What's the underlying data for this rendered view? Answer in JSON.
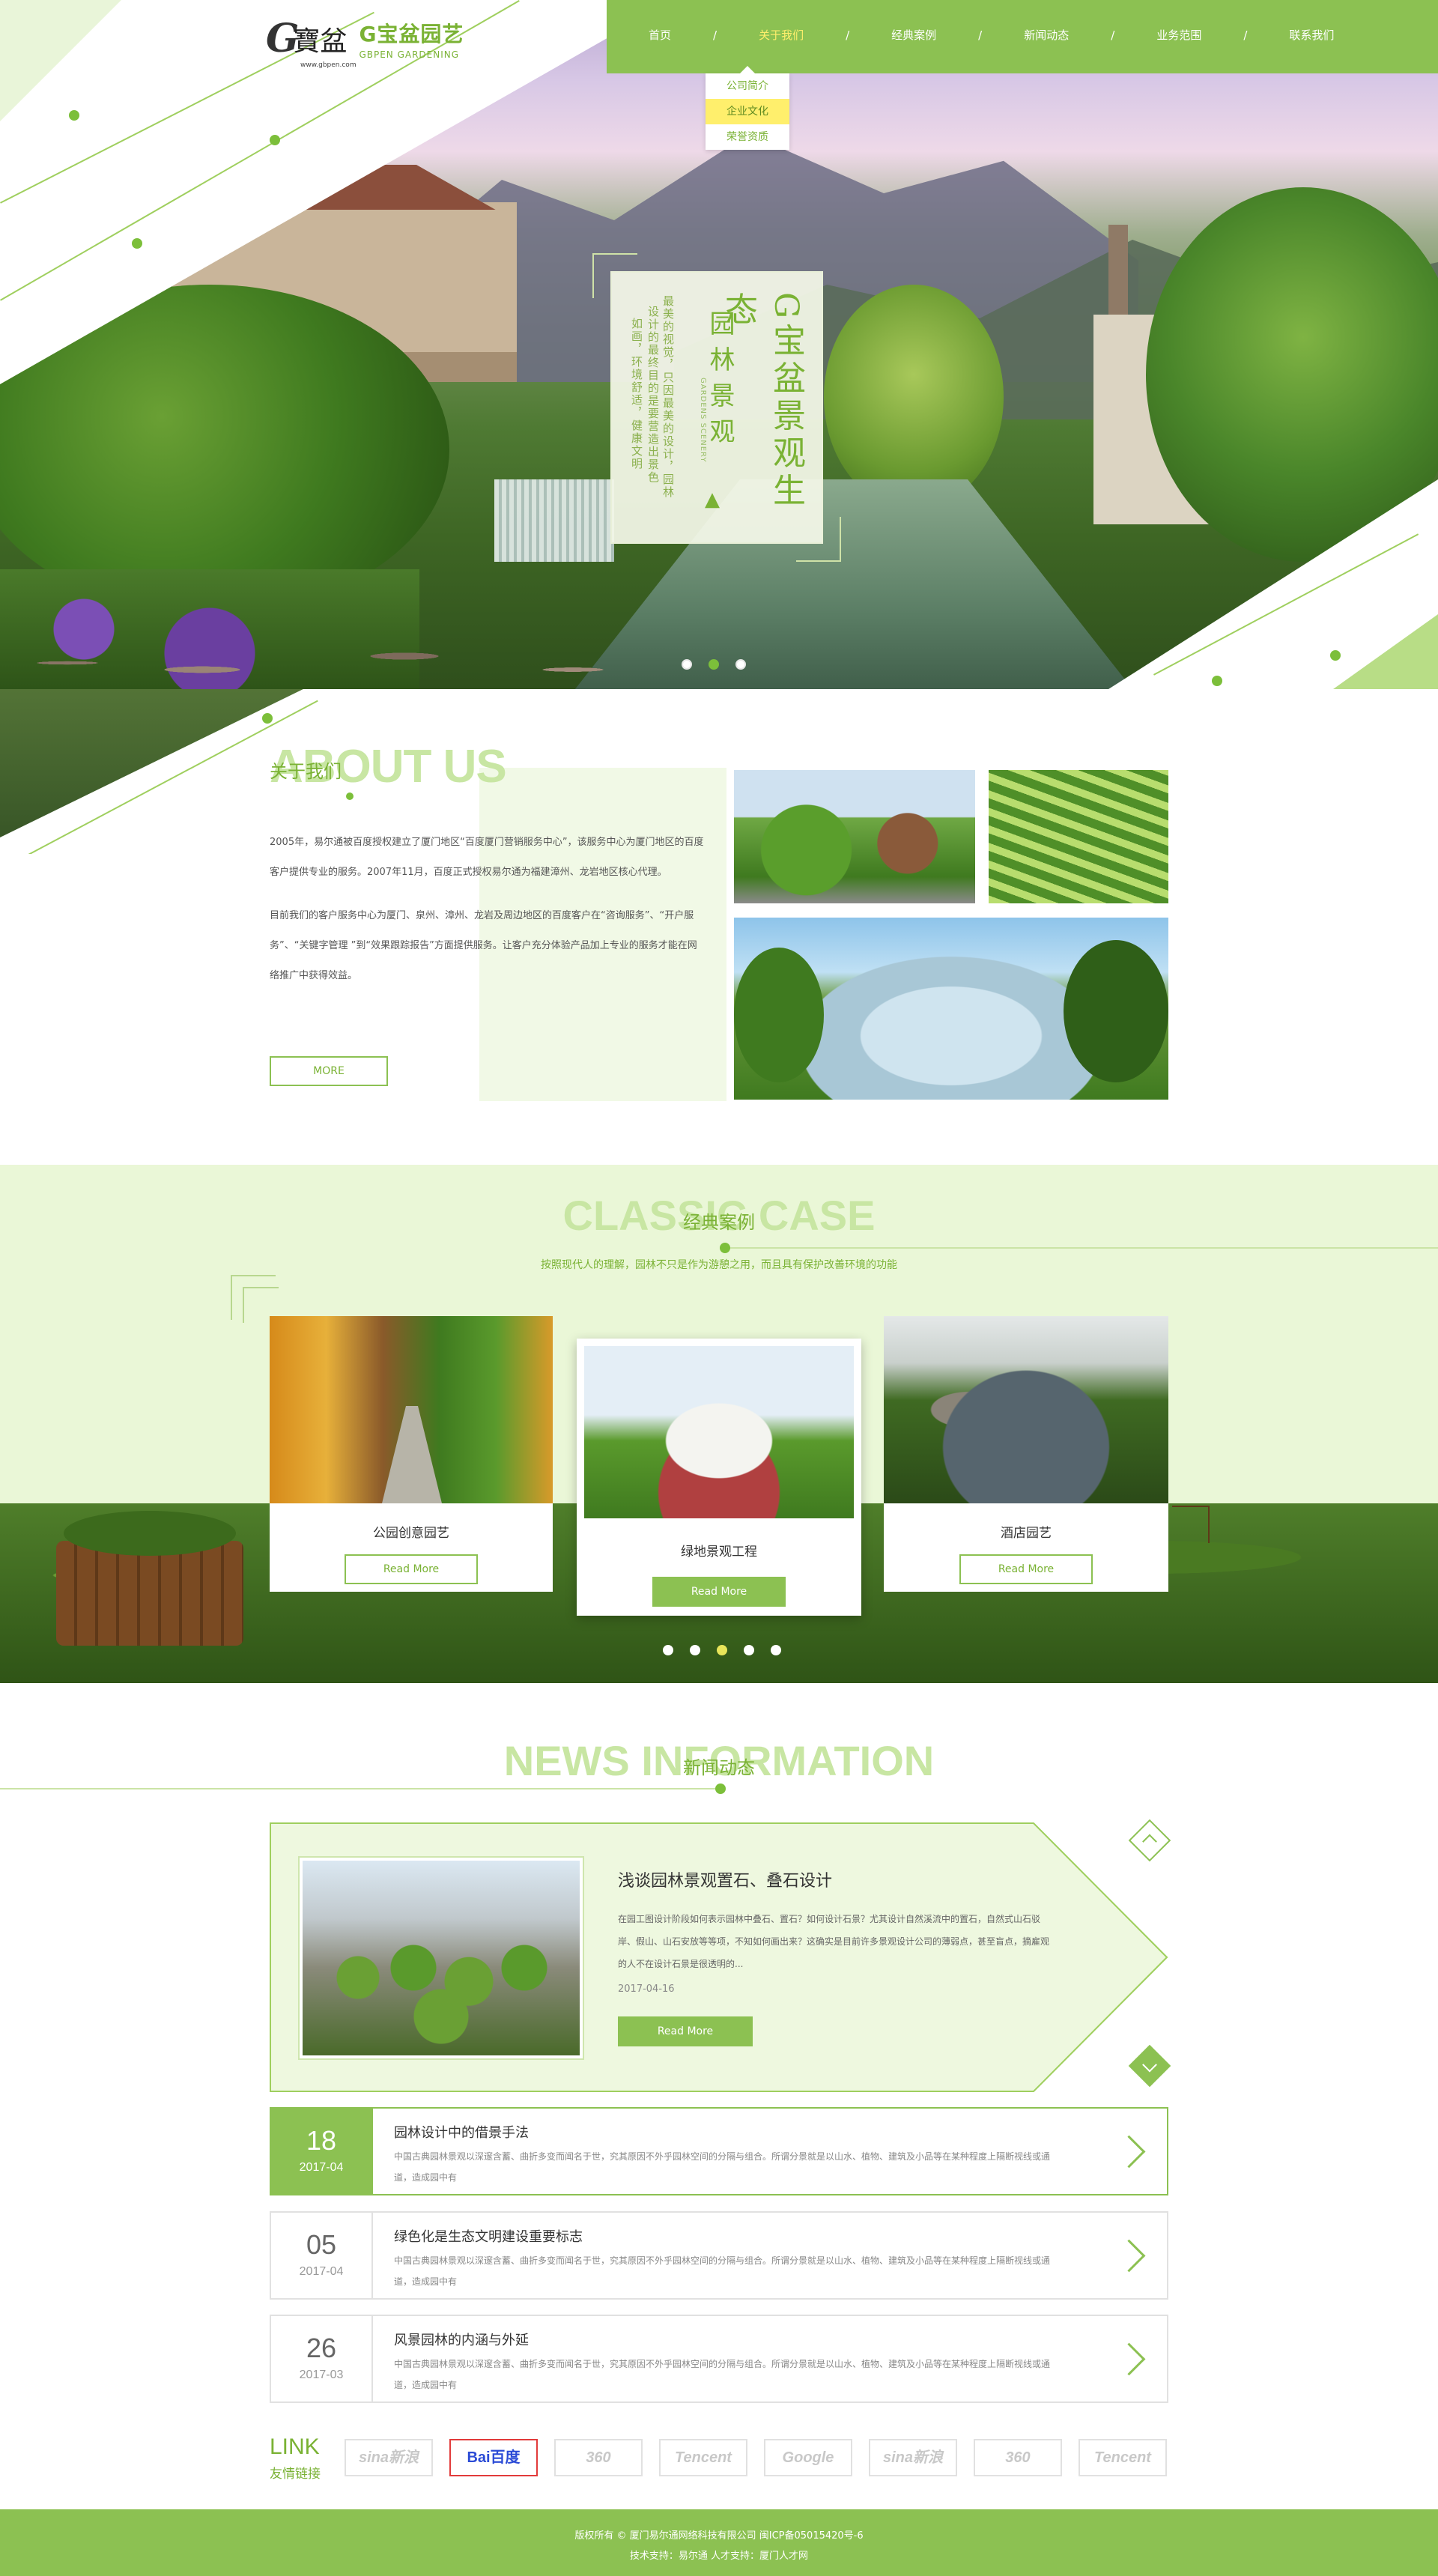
{
  "header": {
    "logo_mark": "G",
    "logo_seal": "寶盆",
    "logo_url": "www.gbpen.com",
    "brand_cn": "G宝盆园艺",
    "brand_en": "GBPEN GARDENING"
  },
  "nav": {
    "items": [
      {
        "label": "首页"
      },
      {
        "label": "关于我们"
      },
      {
        "label": "经典案例"
      },
      {
        "label": "新闻动态"
      },
      {
        "label": "业务范围"
      },
      {
        "label": "联系我们"
      }
    ],
    "separator": "/",
    "active_index": 1,
    "dropdown": [
      {
        "label": "公司简介"
      },
      {
        "label": "企业文化"
      },
      {
        "label": "荣誉资质"
      }
    ],
    "dropdown_active_index": 1
  },
  "hero": {
    "headline": "G宝盆景观生态",
    "subtitle_cn": "园林景观",
    "subtitle_en": "GARDENS SCENERY",
    "tree_glyph": "▲",
    "poem_line1": "最美的视觉，只因最美的设计，园林",
    "poem_line2": "设计的最终目的是要营造出景色",
    "poem_line3": "如画，环境舒适，健康文明",
    "slide_count": 3,
    "active_slide": 2
  },
  "about": {
    "title_en": "ABOUT US",
    "title_cn": "关于我们",
    "para1": "2005年，易尔通被百度授权建立了厦门地区“百度厦门营销服务中心”，该服务中心为厦门地区的百度客户提供专业的服务。2007年11月，百度正式授权易尔通为福建漳州、龙岩地区核心代理。",
    "para2": "目前我们的客户服务中心为厦门、泉州、漳州、龙岩及周边地区的百度客户在“咨询服务”、“开户服务”、“关键字管理 ”到“效果跟踪报告”方面提供服务。让客户充分体验产品加上专业的服务才能在网络推广中获得效益。",
    "more_label": "MORE"
  },
  "cases": {
    "title_en": "CLASSIC CASE",
    "title_cn": "经典案例",
    "subtitle": "按照现代人的理解，园林不只是作为游憩之用，而且具有保护改善环境的功能",
    "items": [
      {
        "title": "公园创意园艺",
        "button": "Read More"
      },
      {
        "title": "绿地景观工程",
        "button": "Read More"
      },
      {
        "title": "酒店园艺",
        "button": "Read More"
      }
    ],
    "dot_count": 5,
    "active_dot": 2
  },
  "news": {
    "title_en": "NEWS INFORMATION",
    "title_cn": "新闻动态",
    "featured": {
      "title": "浅谈园林景观置石、叠石设计",
      "text": "在园工图设计阶段如何表示园林中叠石、置石？如何设计石景？尤其设计自然溪流中的置石，自然式山石驳岸、假山、山石安放等等项，不知如何画出来？这确实是目前许多景观设计公司的薄弱点，甚至盲点，摘雇观的人不在设计石景是很透明的...",
      "date": "2017-04-16",
      "button": "Read More"
    },
    "list": [
      {
        "day": "18",
        "ym": "2017-04",
        "title": "园林设计中的借景手法",
        "desc": "中国古典园林景观以深邃含蓄、曲折多变而闻名于世，究其原因不外乎园林空间的分隔与组合。所谓分景就是以山水、植物、建筑及小品等在某种程度上隔断视线或通道，造成园中有"
      },
      {
        "day": "05",
        "ym": "2017-04",
        "title": "绿色化是生态文明建设重要标志",
        "desc": "中国古典园林景观以深邃含蓄、曲折多变而闻名于世，究其原因不外乎园林空间的分隔与组合。所谓分景就是以山水、植物、建筑及小品等在某种程度上隔断视线或通道，造成园中有"
      },
      {
        "day": "26",
        "ym": "2017-03",
        "title": "风景园林的内涵与外延",
        "desc": "中国古典园林景观以深邃含蓄、曲折多变而闻名于世，究其原因不外乎园林空间的分隔与组合。所谓分景就是以山水、植物、建筑及小品等在某种程度上隔断视线或通道，造成园中有"
      }
    ]
  },
  "links": {
    "title_en": "LINK",
    "title_cn": "友情链接",
    "partners": [
      {
        "name": "sina新浪"
      },
      {
        "name": "Bai百度"
      },
      {
        "name": "360"
      },
      {
        "name": "Tencent"
      },
      {
        "name": "Google"
      },
      {
        "name": "sina新浪"
      },
      {
        "name": "360"
      },
      {
        "name": "Tencent"
      }
    ]
  },
  "footer": {
    "line1": "版权所有 © 厦门易尔通网络科技有限公司 闽ICP备05015420号-6",
    "line2": "技术支持：易尔通   人才支持：厦门人才网"
  },
  "colors": {
    "brand_green": "#8cc152",
    "accent_yellow": "#ffef6c",
    "light_green": "#eaf7d7"
  }
}
